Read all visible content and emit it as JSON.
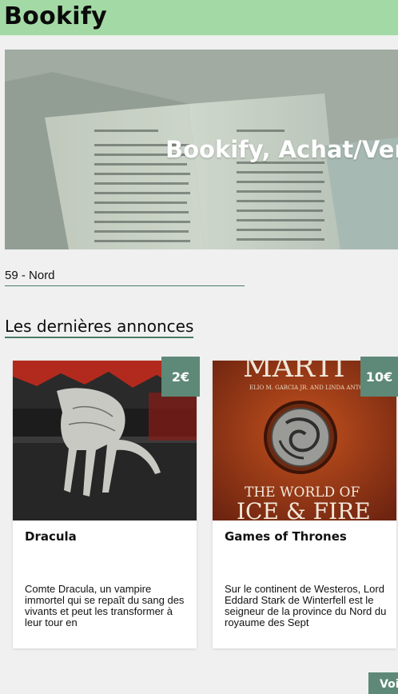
{
  "header": {
    "brand": "Bookify"
  },
  "hero": {
    "title": "Bookify, Achat/Vente",
    "image_icon": "open-book-photo"
  },
  "location": {
    "value": "59 - Nord"
  },
  "section": {
    "title": "Les dernières annonces"
  },
  "listings": [
    {
      "title": "Dracula",
      "price": "2€",
      "description": "Comte Dracula, un vampire immortel qui se repaît du sang des vivants et peut les transformer à leur tour en",
      "cover_icon": "claw-hand-cover"
    },
    {
      "title": "Games of Thrones",
      "price": "10€",
      "description": "Sur le continent de Westeros, Lord Eddard Stark de Winterfell est le seigneur de la province du Nord du royaume des Sept",
      "cover_icon": "dragon-sigil-cover",
      "cover_text": {
        "top": "MARTI",
        "authors": "ELIO M. GARCIA JR. AND LINDA ANTON",
        "bottom_line1": "THE WORLD OF",
        "bottom_line2": "ICE & FIRE"
      }
    }
  ],
  "actions": {
    "voir_label": "Voir"
  },
  "colors": {
    "header_bg": "#a3d9a5",
    "accent": "#5e8978",
    "page_bg": "#f0f0f0"
  }
}
